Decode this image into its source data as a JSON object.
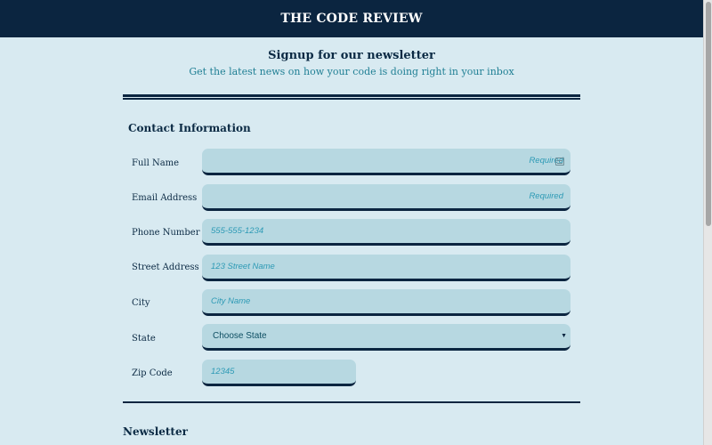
{
  "header": {
    "title": "THE CODE REVIEW"
  },
  "intro": {
    "title": "Signup for our newsletter",
    "subtitle": "Get the latest news on how your code is doing right in your inbox"
  },
  "contact": {
    "heading": "Contact Information",
    "fields": [
      {
        "label": "Full Name",
        "placeholder": "Required"
      },
      {
        "label": "Email Address",
        "placeholder": "Required"
      },
      {
        "label": "Phone Number",
        "placeholder": "555-555-1234"
      },
      {
        "label": "Street Address",
        "placeholder": "123 Street Name"
      },
      {
        "label": "City",
        "placeholder": "City Name"
      },
      {
        "label": "State",
        "value": "Choose State"
      },
      {
        "label": "Zip Code",
        "placeholder": "12345"
      }
    ]
  },
  "newsletter": {
    "heading": "Newsletter"
  },
  "icons": {
    "autofill": "contact-card-icon",
    "select_caret": "caret-down-icon"
  },
  "colors": {
    "header_bg": "#0b2540",
    "page_bg": "#d8eaf1",
    "field_bg": "#b7d8e1",
    "accent": "#1f7f94"
  }
}
